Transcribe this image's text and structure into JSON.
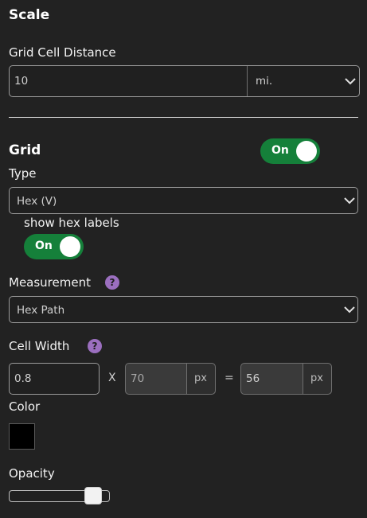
{
  "scale": {
    "heading": "Scale",
    "grid_cell_distance_label": "Grid Cell Distance",
    "distance_value": "10",
    "distance_unit": "mi."
  },
  "grid": {
    "heading": "Grid",
    "toggle_label": "On",
    "enabled": true,
    "type_label": "Type",
    "type_value": "Hex (V)",
    "show_hex_labels_label": "show hex labels",
    "hex_labels_toggle_label": "On",
    "hex_labels_enabled": true,
    "measurement_label": "Measurement",
    "measurement_help": "?",
    "measurement_value": "Hex Path",
    "cell_width_label": "Cell Width",
    "cell_width_help": "?",
    "cell_width_multiplier": "0.8",
    "times_symbol": "X",
    "cell_width_px_value": "70",
    "px_unit_1": "px",
    "equals_symbol": "=",
    "cell_width_result": "56",
    "px_unit_2": "px",
    "color_label": "Color",
    "color_value": "#000000",
    "opacity_label": "Opacity",
    "opacity_fraction": 0.9
  },
  "accent_colors": {
    "toggle_on": "#15803a",
    "help_badge": "#9b6fbf"
  }
}
